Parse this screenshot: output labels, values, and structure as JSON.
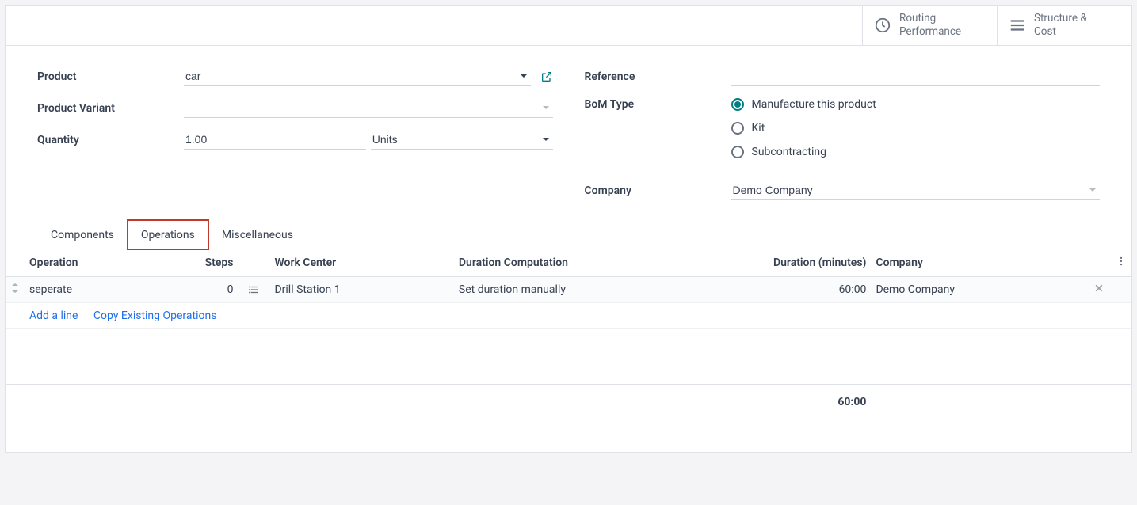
{
  "stats": {
    "routing_l1": "Routing",
    "routing_l2": "Performance",
    "structure_l1": "Structure &",
    "structure_l2": "Cost"
  },
  "labels": {
    "product": "Product",
    "product_variant": "Product Variant",
    "quantity": "Quantity",
    "reference": "Reference",
    "bom_type": "BoM Type",
    "company": "Company"
  },
  "fields": {
    "product": "car",
    "product_variant": "",
    "qty": "1.00",
    "qty_unit": "Units",
    "reference": "",
    "company": "Demo Company"
  },
  "bom_type": {
    "opt1": "Manufacture this product",
    "opt2": "Kit",
    "opt3": "Subcontracting"
  },
  "tabs": {
    "components": "Components",
    "operations": "Operations",
    "misc": "Miscellaneous"
  },
  "table": {
    "headers": {
      "operation": "Operation",
      "steps": "Steps",
      "work_center": "Work Center",
      "duration_comp": "Duration Computation",
      "duration_min": "Duration (minutes)",
      "company": "Company"
    },
    "row": {
      "operation": "seperate",
      "steps": "0",
      "work_center": "Drill Station 1",
      "duration_comp": "Set duration manually",
      "duration_min": "60:00",
      "company": "Demo Company"
    },
    "add_line": "Add a line",
    "copy_ops": "Copy Existing Operations",
    "total_duration": "60:00"
  }
}
